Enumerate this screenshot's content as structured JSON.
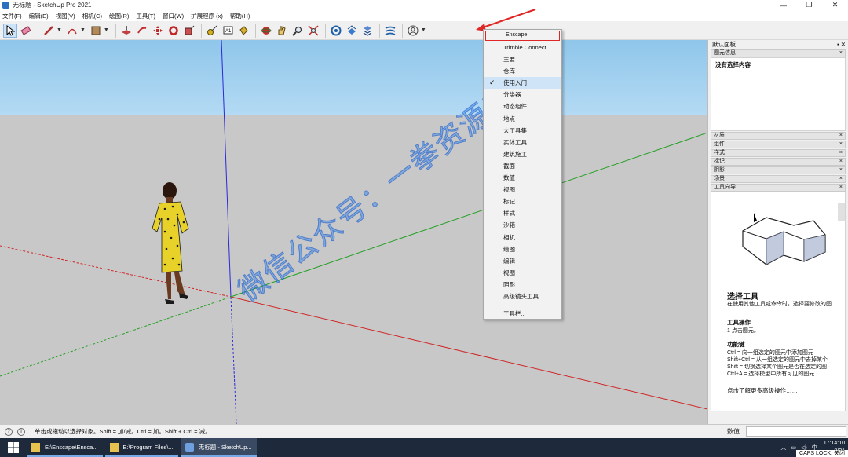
{
  "window": {
    "title": "无标题 - SketchUp Pro 2021",
    "controls": [
      "—",
      "❐",
      "✕"
    ]
  },
  "menubar": [
    "文件(F)",
    "编辑(E)",
    "视图(V)",
    "相机(C)",
    "绘图(R)",
    "工具(T)",
    "窗口(W)",
    "扩展程序 (x)",
    "帮助(H)"
  ],
  "toolbar_icons": [
    "select-icon",
    "eraser-icon",
    "pencil-icon",
    "arc-icon",
    "shape-icon",
    "push-pull-icon",
    "follow-me-icon",
    "move-icon",
    "rotate-icon",
    "scale-icon",
    "tape-measure-icon",
    "text-icon",
    "paint-bucket-icon",
    "orbit-icon",
    "pan-icon",
    "zoom-icon",
    "zoom-extents-icon",
    "3d-warehouse-icon",
    "extension-warehouse-icon",
    "layout-icon",
    "extension-manager-icon",
    "account-icon"
  ],
  "dropdown": {
    "items": [
      {
        "label": "Enscape",
        "boxed": true
      },
      {
        "label": "Trimble Connect"
      },
      {
        "label": "主要"
      },
      {
        "label": "仓库"
      },
      {
        "label": "使用入门",
        "checked": true
      },
      {
        "label": "分类器"
      },
      {
        "label": "动态组件"
      },
      {
        "label": "地点"
      },
      {
        "label": "大工具集"
      },
      {
        "label": "实体工具"
      },
      {
        "label": "建筑施工"
      },
      {
        "label": "截面"
      },
      {
        "label": "数值"
      },
      {
        "label": "视图"
      },
      {
        "label": "标记"
      },
      {
        "label": "样式"
      },
      {
        "label": "沙箱"
      },
      {
        "label": "相机"
      },
      {
        "label": "绘图"
      },
      {
        "label": "编辑"
      },
      {
        "label": "视图"
      },
      {
        "label": "阴影"
      },
      {
        "label": "高级镜头工具"
      }
    ],
    "footer": "工具栏..."
  },
  "watermark": "微信公众号：一拳资源库",
  "right_panel": {
    "title": "默认面板",
    "entity_info": {
      "label": "图元信息",
      "body": "没有选择内容"
    },
    "sections": [
      "材质",
      "组件",
      "样式",
      "标记",
      "阴影",
      "场景"
    ],
    "instructor": {
      "label": "工具向导",
      "title": "选择工具",
      "desc": "在使用其他工具或命令时，选择要修改的图",
      "op_heading": "工具操作",
      "op_line": "1  点击图元。",
      "keys_heading": "功能键",
      "keys": [
        "Ctrl = 向一组选定的图元中添加图元",
        "Shift+Ctrl = 从一组选定的图元中去掉某个",
        "Shift = 切换选择某个图元是否在选定的图",
        "Ctrl+A = 选择模型中所有可见的图元"
      ],
      "more": "点击了解更多高级操作……"
    }
  },
  "statusbar": {
    "text": "单击或拖动以选择对象。Shift = 加/减。Ctrl = 加。Shift + Ctrl = 减。",
    "measure_label": "数值"
  },
  "taskbar": {
    "tasks": [
      "E:\\Enscape\\Ensca...",
      "E:\\Program Files\\...",
      "无标题 - SketchUp..."
    ],
    "tray": "中",
    "time": "17:14:10",
    "date": "8/21",
    "caps": "CAPS LOCK: 关闭"
  }
}
